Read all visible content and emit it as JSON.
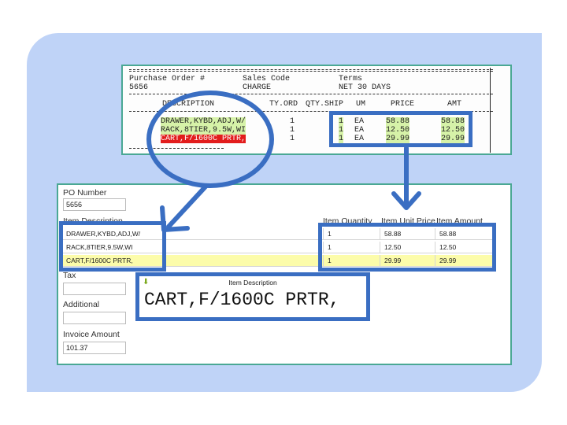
{
  "document": {
    "header_labels": [
      "Purchase Order #",
      "Sales Code",
      "Terms"
    ],
    "header_values": [
      "5656",
      "CHARGE",
      "NET 30 DAYS"
    ],
    "columns": [
      "DESCRIPTION",
      "QTY.ORD",
      "QTY.SHIP",
      "UM",
      "PRICE",
      "AMT"
    ],
    "columns_visible": [
      "DESCRIPTION",
      "TY.ORD",
      "QTY.SHIP",
      "UM",
      "PRICE",
      "AMT"
    ],
    "rows": [
      {
        "desc": "DRAWER,KYBD,ADJ,W/",
        "qty_ord": "1",
        "qty_ship": "1",
        "um": "EA",
        "price": "58.88",
        "amt": "58.88"
      },
      {
        "desc": "RACK,8TIER,9.5W,WI",
        "qty_ord": "1",
        "qty_ship": "1",
        "um": "EA",
        "price": "12.50",
        "amt": "12.50"
      },
      {
        "desc": "CART,F/1600C PRTR,",
        "qty_ord": "1",
        "qty_ship": "1",
        "um": "EA",
        "price": "29.99",
        "amt": "29.99"
      }
    ],
    "header_label_visible": [
      "Purchase Order #",
      "Sales Code",
      "Terms"
    ]
  },
  "form": {
    "po_number_label": "PO Number",
    "po_number_value": "5656",
    "item_table": {
      "headers": [
        "Item Description",
        "Item Quantity",
        "Item Unit Price",
        "Item Amount"
      ],
      "rows": [
        {
          "desc": "DRAWER,KYBD,ADJ,W/",
          "qty": "1",
          "price": "58.88",
          "amount": "58.88"
        },
        {
          "desc": "RACK,8TIER,9.5W,WI",
          "qty": "1",
          "price": "12.50",
          "amount": "12.50"
        },
        {
          "desc": "CART,F/1600C PRTR,",
          "qty": "1",
          "price": "29.99",
          "amount": "29.99"
        }
      ]
    },
    "tax_label": "Tax",
    "tax_value": "",
    "additional_label": "Additional",
    "additional_value": "",
    "invoice_amount_label": "Invoice Amount",
    "invoice_amount_value": "101.37"
  },
  "popup": {
    "title": "Item Description",
    "value": "CART,F/1600C PRTR,"
  },
  "icons": {
    "dropdown": "chevron-down-icon",
    "download": "down-arrow-icon"
  },
  "colors": {
    "highlight_blue": "#3a6ec2",
    "frame_teal": "#4aa894",
    "background_panel": "#bfd3f7",
    "scan_green": "#d6f2a8",
    "scan_red": "#e21c1c",
    "selected_row": "#fcfcaa"
  }
}
